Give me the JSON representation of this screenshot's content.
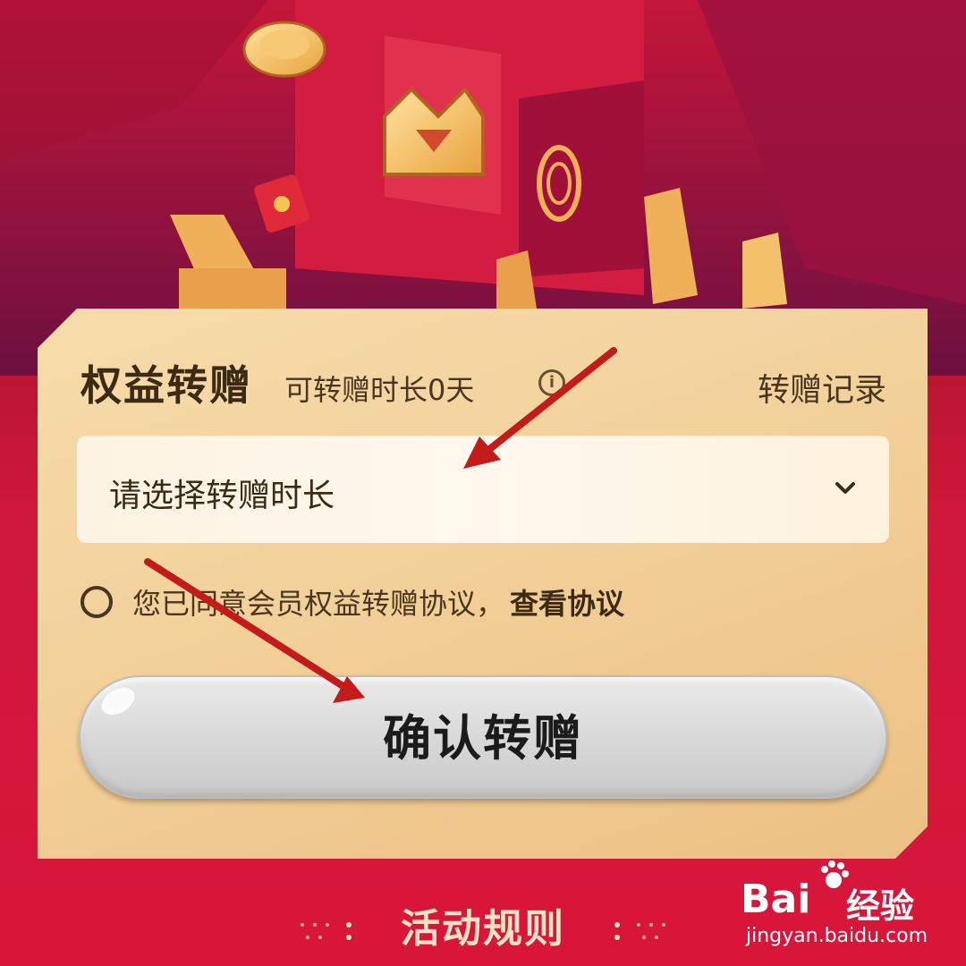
{
  "panel": {
    "title": "权益转赠",
    "subtitle": "可转赠时长0天",
    "record_link": "转赠记录"
  },
  "duration_select": {
    "placeholder": "请选择转赠时长"
  },
  "agreement": {
    "text": "您已同意会员权益转赠协议，",
    "link": "查看协议"
  },
  "confirm_button": {
    "label": "确认转赠"
  },
  "rules_link": {
    "label": "活动规则"
  },
  "watermark": {
    "brand": "Bai",
    "brand_cn": "经验",
    "url": "jingyan.baidu.com"
  },
  "colors": {
    "background": "#d0183a",
    "panel": "#f3d29c",
    "text_dark": "#3c2a15",
    "button_disabled": "#d9d9d9",
    "annotation_arrow": "#c41a1a"
  }
}
